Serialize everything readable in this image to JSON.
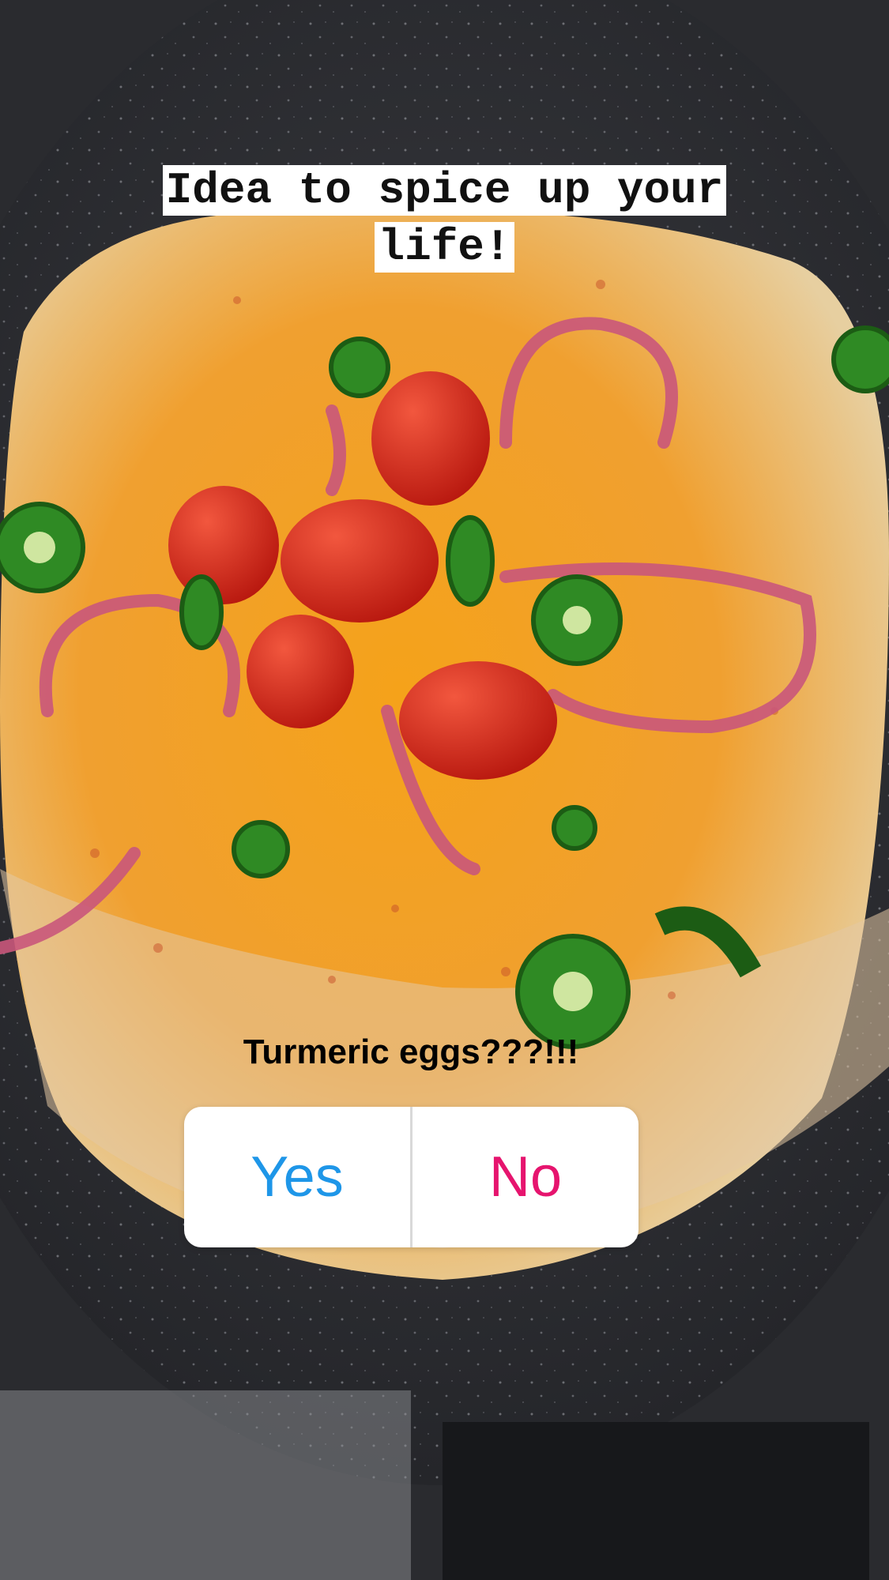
{
  "caption": {
    "line1": "Idea to spice up your",
    "line2": "life!"
  },
  "poll": {
    "question": "Turmeric eggs???!!!",
    "options": [
      {
        "label": "Yes",
        "color": "#1e96e8"
      },
      {
        "label": "No",
        "color": "#e6146e"
      }
    ]
  },
  "colors": {
    "pan": "#2c2d31",
    "egg_yolk": "#f29a12",
    "tomato": "#d8261e",
    "onion": "#c9577b",
    "jalapeno": "#2f8a24"
  }
}
